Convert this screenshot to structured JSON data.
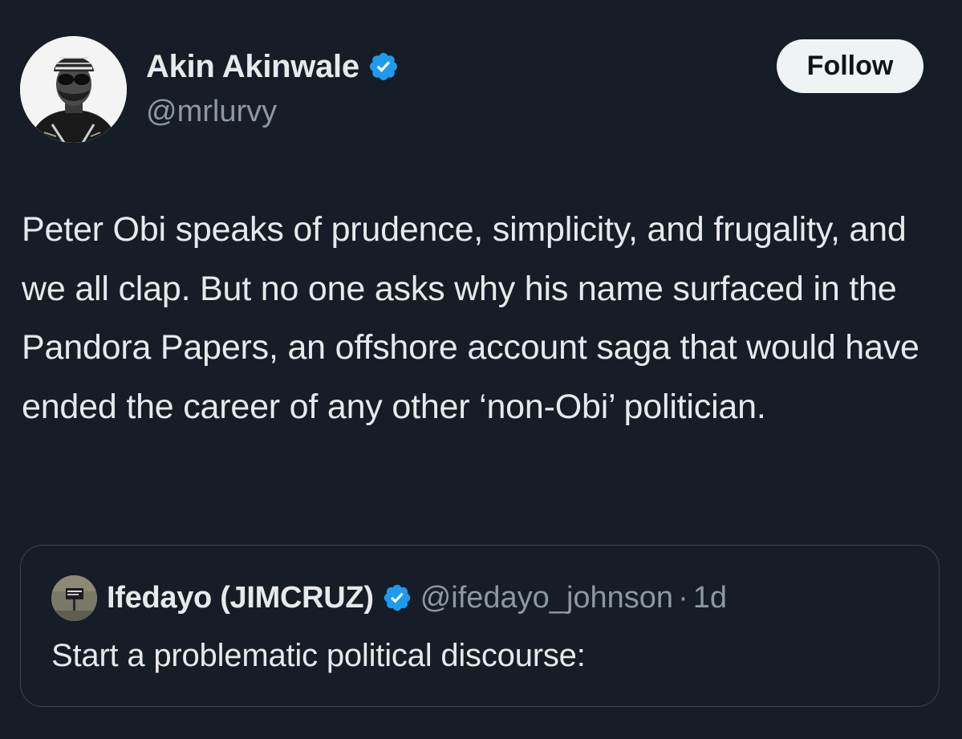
{
  "author": {
    "display_name": "Akin Akinwale",
    "handle": "@mrlurvy",
    "verified_icon": "verified-badge-icon"
  },
  "follow_label": "Follow",
  "tweet": {
    "text": "Peter Obi speaks of prudence, simplicity, and frugality, and we all clap. But no one asks why his name surfaced in the Pandora Papers, an offshore account saga that would have ended the career of any other ‘non-Obi’ politician."
  },
  "quoted_tweet": {
    "display_name": "Ifedayo (JIMCRUZ)",
    "handle": "@ifedayo_johnson",
    "separator": "·",
    "time": "1d",
    "text": "Start a problematic political discourse:"
  },
  "colors": {
    "background": "#161d26",
    "verified_blue": "#1d9bf0",
    "follow_button_bg": "#eff3f4",
    "secondary_text": "#8b98a5"
  }
}
